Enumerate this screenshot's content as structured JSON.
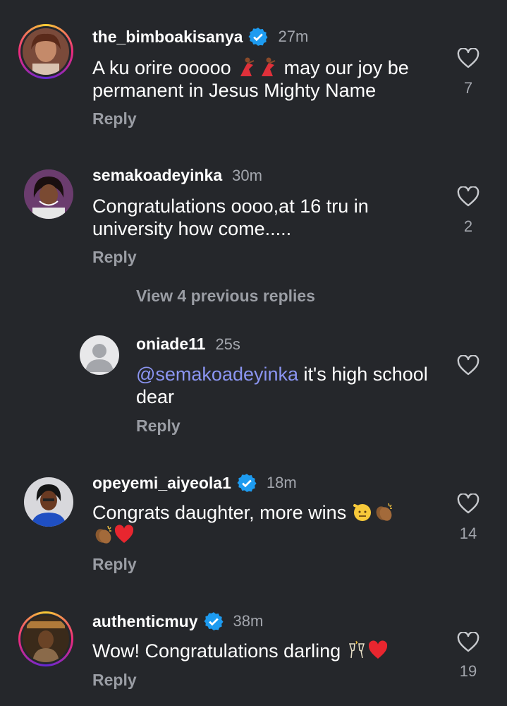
{
  "comments": [
    {
      "username": "the_bimboakisanya",
      "verified": true,
      "time": "27m",
      "text_parts": [
        "A ku orire ooooo ",
        " may our joy be permanent in Jesus Mighty Name"
      ],
      "reply_label": "Reply",
      "like_count": "7"
    },
    {
      "username": "semakoadeyinka",
      "verified": false,
      "time": "30m",
      "text": "Congratulations oooo,at 16 tru in university how come.....",
      "reply_label": "Reply",
      "like_count": "2",
      "view_replies_label": "View 4 previous replies"
    },
    {
      "username": "oniade11",
      "verified": false,
      "time": "25s",
      "mention": "@semakoadeyinka",
      "text": " it's high school dear",
      "reply_label": "Reply",
      "like_count": ""
    },
    {
      "username": "opeyemi_aiyeola1",
      "verified": true,
      "time": "18m",
      "text": "Congrats daughter, more wins ",
      "reply_label": "Reply",
      "like_count": "14"
    },
    {
      "username": "authenticmuy",
      "verified": true,
      "time": "38m",
      "text": "Wow! Congratulations darling ",
      "reply_label": "Reply",
      "like_count": "19"
    }
  ],
  "colors": {
    "background": "#25272b",
    "verified_blue": "#1d9bf0",
    "mention": "#8b95f2",
    "muted_text": "#a3a6ad"
  },
  "icons": [
    "heart-outline-icon",
    "verified-badge-icon",
    "dancer-emoji",
    "saluting-face-emoji",
    "clapping-hands-emoji",
    "red-heart-emoji",
    "champagne-emoji",
    "default-avatar-icon"
  ]
}
